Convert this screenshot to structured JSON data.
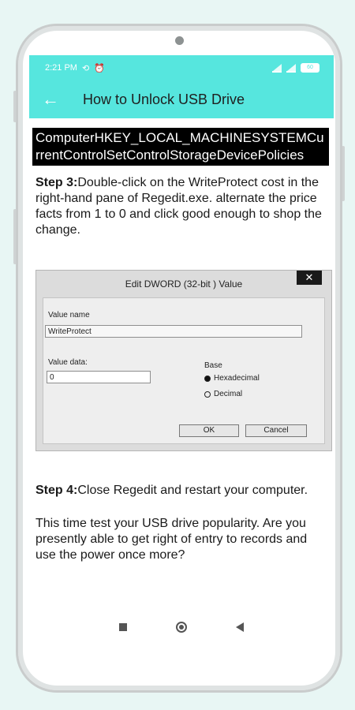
{
  "status": {
    "time": "2:21 PM",
    "battery": "60"
  },
  "appbar": {
    "title": "How to Unlock USB Drive"
  },
  "path_box": "ComputerHKEY_LOCAL_MACHINESYSTEMCurrentControlSetControlStorageDevicePolicies",
  "step3": {
    "label": "Step 3:",
    "text": "Double-click on the WriteProtect cost in the right-hand pane of Regedit.exe. alternate the price facts from 1 to 0 and click good enough to shop the change."
  },
  "dialog": {
    "title": "Edit DWORD (32-bit ) Value",
    "close": "✕",
    "value_name_label": "Value name",
    "value_name": "WriteProtect",
    "value_data_label": "Value data:",
    "value_data": "0",
    "base_label": "Base",
    "hex_label": "Hexadecimal",
    "dec_label": "Decimal",
    "ok": "OK",
    "cancel": "Cancel"
  },
  "step4": {
    "label": "Step 4:",
    "text": "Close Regedit and restart your computer."
  },
  "paragraph": "This time test your USB drive popularity. Are you presently able to get right of entry to records and use the power once more?"
}
